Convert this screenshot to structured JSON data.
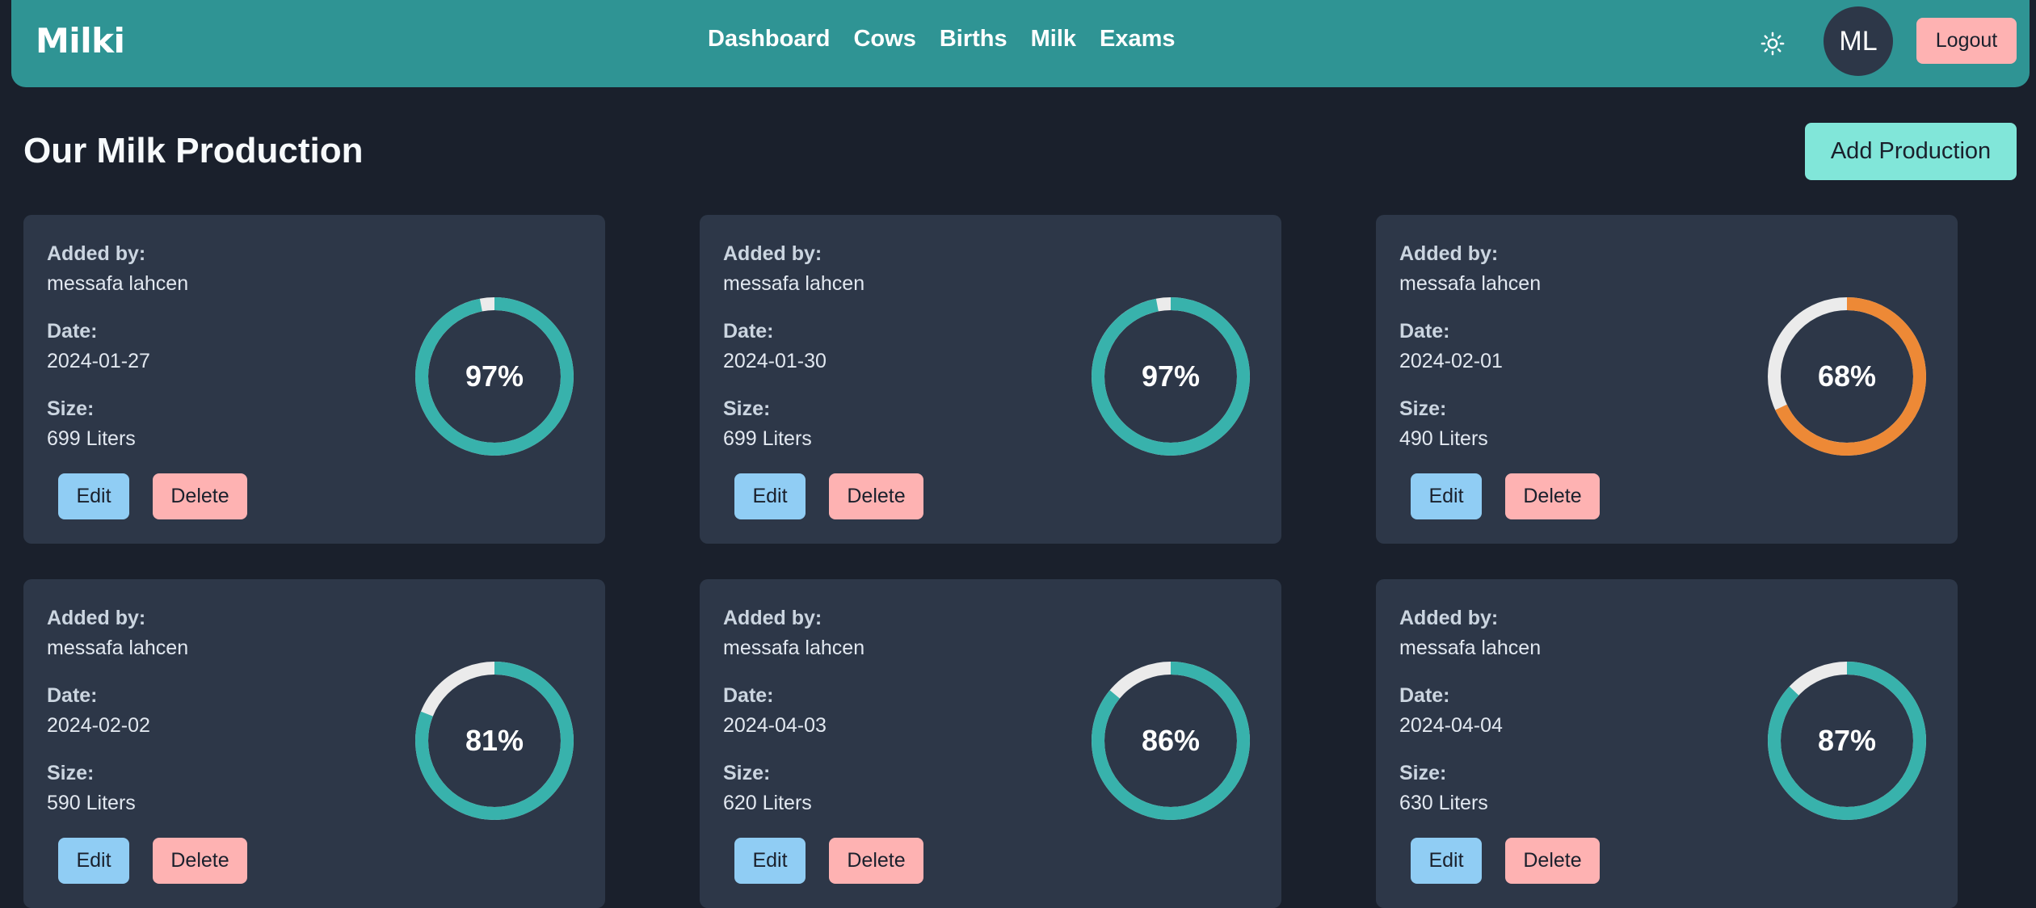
{
  "nav": {
    "brand": "Milki",
    "links": [
      "Dashboard",
      "Cows",
      "Births",
      "Milk",
      "Exams"
    ],
    "avatar_initials": "ML",
    "logout_label": "Logout",
    "theme_icon": "sun-icon"
  },
  "page": {
    "title": "Our Milk Production",
    "add_label": "Add Production"
  },
  "labels": {
    "added_by": "Added by:",
    "date": "Date:",
    "size": "Size:",
    "edit": "Edit",
    "delete": "Delete"
  },
  "colors": {
    "teal": "#38b2ac",
    "orange": "#ed8936",
    "track": "#ebebeb"
  },
  "productions": [
    {
      "added_by": "messafa lahcen",
      "date": "2024-01-27",
      "size": "699 Liters",
      "percent": 97,
      "percent_label": "97%",
      "color": "#38b2ac"
    },
    {
      "added_by": "messafa lahcen",
      "date": "2024-01-30",
      "size": "699 Liters",
      "percent": 97,
      "percent_label": "97%",
      "color": "#38b2ac"
    },
    {
      "added_by": "messafa lahcen",
      "date": "2024-02-01",
      "size": "490 Liters",
      "percent": 68,
      "percent_label": "68%",
      "color": "#ed8936"
    },
    {
      "added_by": "messafa lahcen",
      "date": "2024-02-02",
      "size": "590 Liters",
      "percent": 81,
      "percent_label": "81%",
      "color": "#38b2ac"
    },
    {
      "added_by": "messafa lahcen",
      "date": "2024-04-03",
      "size": "620 Liters",
      "percent": 86,
      "percent_label": "86%",
      "color": "#38b2ac"
    },
    {
      "added_by": "messafa lahcen",
      "date": "2024-04-04",
      "size": "630 Liters",
      "percent": 87,
      "percent_label": "87%",
      "color": "#38b2ac"
    }
  ]
}
